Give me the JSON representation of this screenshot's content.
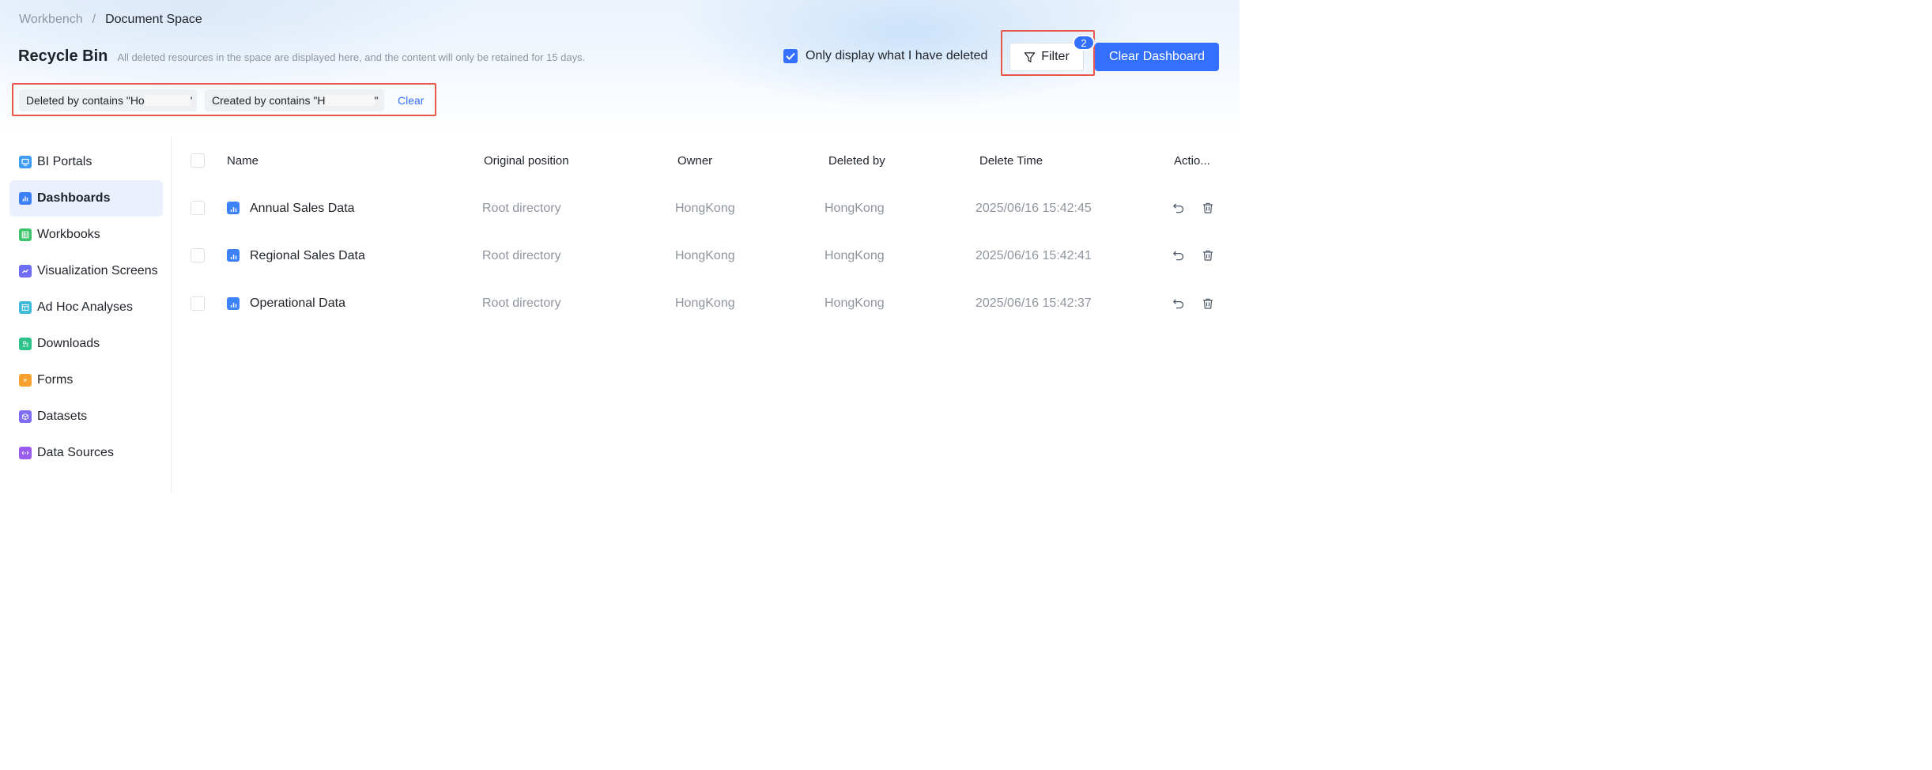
{
  "breadcrumb": {
    "parent": "Workbench",
    "separator": "/",
    "current": "Document Space"
  },
  "header": {
    "title": "Recycle Bin",
    "description": "All deleted resources in the space are displayed here, and the content will only be retained for 15 days.",
    "only_mine_label": "Only display what I have deleted",
    "only_mine_checked": true,
    "filter_label": "Filter",
    "filter_count": "2",
    "clear_dashboard_label": "Clear Dashboard"
  },
  "filters": {
    "tags": [
      {
        "prefix": "Deleted by contains \"Ho",
        "suffix": "'"
      },
      {
        "prefix": "Created by contains \"H",
        "suffix": "\""
      }
    ],
    "clear_label": "Clear"
  },
  "sidebar": {
    "active_index": 1,
    "items": [
      {
        "label": "BI Portals",
        "icon": "monitor-icon",
        "color": "#3d9cf5"
      },
      {
        "label": "Dashboards",
        "icon": "bar-chart-icon",
        "color": "#3d82f8"
      },
      {
        "label": "Workbooks",
        "icon": "grid-icon",
        "color": "#3cc46c"
      },
      {
        "label": "Visualization Screens",
        "icon": "line-chart-icon",
        "color": "#6f6cf6"
      },
      {
        "label": "Ad Hoc Analyses",
        "icon": "calendar-table-icon",
        "color": "#3fb8d9"
      },
      {
        "label": "Downloads",
        "icon": "download-list-icon",
        "color": "#2ec28b"
      },
      {
        "label": "Forms",
        "icon": "form-icon",
        "color": "#f6a12e"
      },
      {
        "label": "Datasets",
        "icon": "cube-icon",
        "color": "#7e6cf3"
      },
      {
        "label": "Data Sources",
        "icon": "code-link-icon",
        "color": "#9a5cf0"
      }
    ]
  },
  "table": {
    "columns": [
      "Name",
      "Original position",
      "Owner",
      "Deleted by",
      "Delete Time",
      "Actio..."
    ],
    "rows": [
      {
        "name": "Annual Sales Data",
        "position": "Root directory",
        "owner": "HongKong",
        "deleted_by": "HongKong",
        "delete_time": "2025/06/16 15:42:45"
      },
      {
        "name": "Regional Sales Data",
        "position": "Root directory",
        "owner": "HongKong",
        "deleted_by": "HongKong",
        "delete_time": "2025/06/16 15:42:41"
      },
      {
        "name": "Operational Data",
        "position": "Root directory",
        "owner": "HongKong",
        "deleted_by": "HongKong",
        "delete_time": "2025/06/16 15:42:37"
      }
    ]
  },
  "colors": {
    "primary": "#3370ff",
    "highlight": "#e8574a",
    "muted_text": "#8f959e"
  }
}
